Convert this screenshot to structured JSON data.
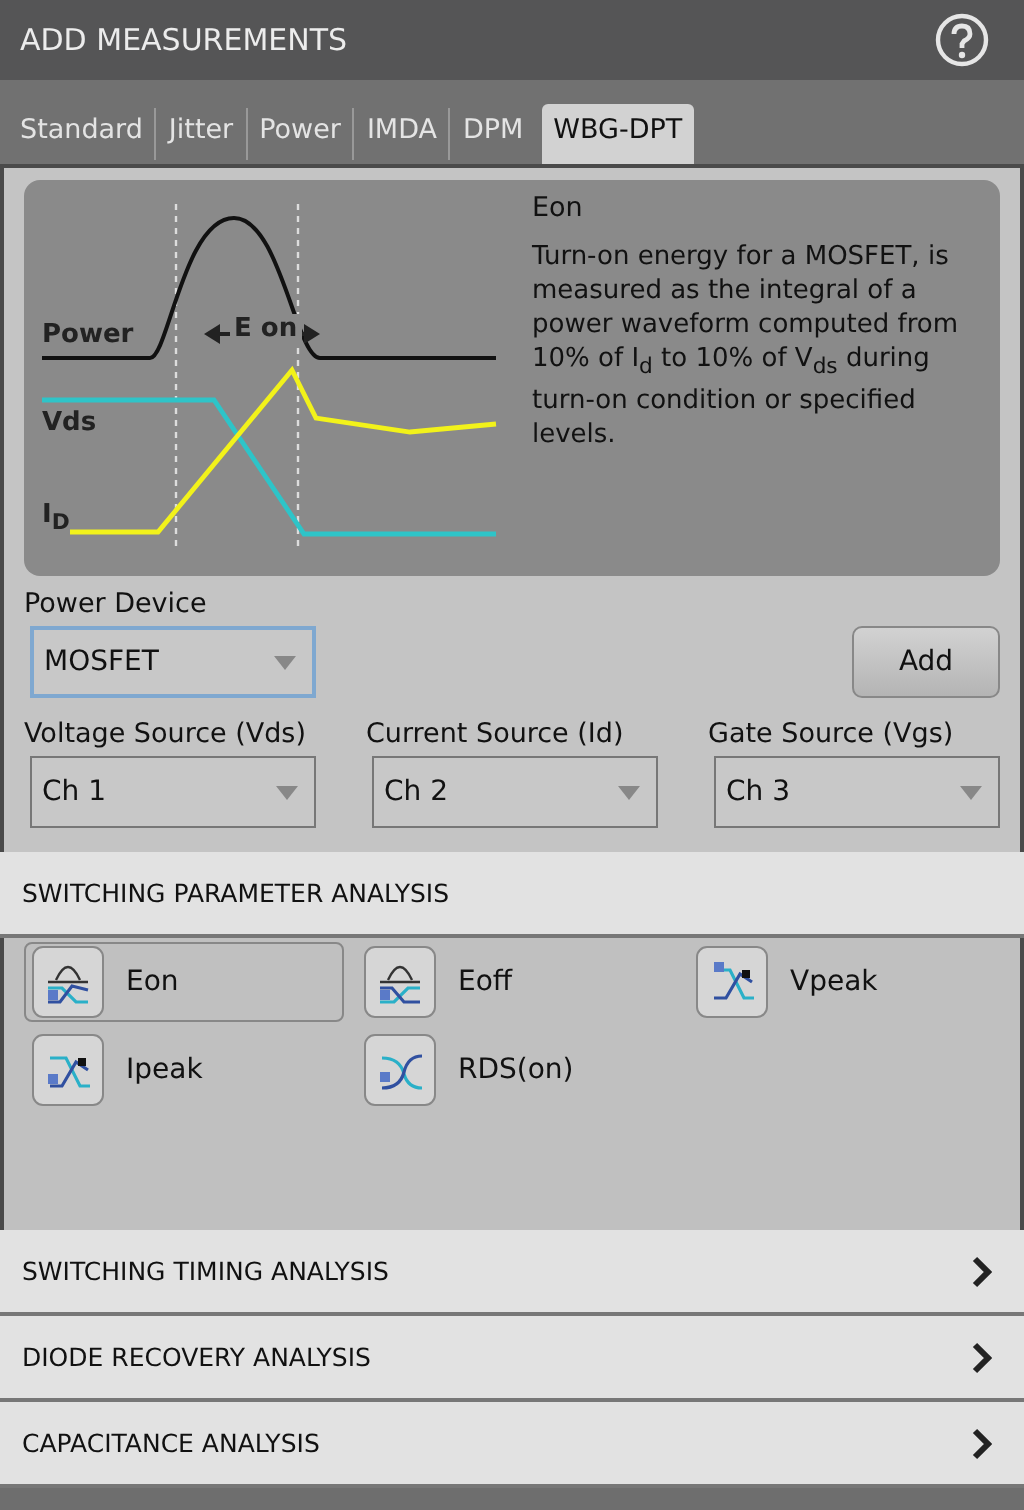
{
  "window": {
    "title": "ADD MEASUREMENTS"
  },
  "tabs": [
    {
      "label": "Standard",
      "selected": false
    },
    {
      "label": "Jitter",
      "selected": false
    },
    {
      "label": "Power",
      "selected": false
    },
    {
      "label": "IMDA",
      "selected": false
    },
    {
      "label": "DPM",
      "selected": false
    },
    {
      "label": "WBG-DPT",
      "selected": true
    }
  ],
  "info": {
    "labels": {
      "power": "Power",
      "eon": "E on",
      "vds": "Vds",
      "id": "I$_{D}$"
    },
    "title": "Eon",
    "description": "Turn-on energy for a MOSFET, is measured as the integral of a power waveform computed from 10% of I$_{d}$ to 10% of V$_{ds}$ during turn-on condition or specified levels."
  },
  "power_device": {
    "label": "Power Device",
    "value": "MOSFET",
    "focused": true
  },
  "add_button": "Add",
  "sources": [
    {
      "label": "Voltage Source (Vds)",
      "value": "Ch 1",
      "focused": false
    },
    {
      "label": "Current Source (Id)",
      "value": "Ch 2",
      "focused": false
    },
    {
      "label": "Gate Source (Vgs)",
      "value": "Ch 3",
      "focused": false
    }
  ],
  "sections": [
    {
      "title": "SWITCHING PARAMETER ANALYSIS",
      "expanded": true,
      "measurements": [
        {
          "label": "Eon",
          "kind": "eon",
          "selected": true
        },
        {
          "label": "Eoff",
          "kind": "eoff",
          "selected": false
        },
        {
          "label": "Vpeak",
          "kind": "vpeak",
          "selected": false
        },
        {
          "label": "Ipeak",
          "kind": "ipeak",
          "selected": false
        },
        {
          "label": "RDS(on)",
          "kind": "rds",
          "selected": false
        }
      ]
    },
    {
      "title": "SWITCHING TIMING ANALYSIS",
      "expanded": false
    },
    {
      "title": "DIODE RECOVERY ANALYSIS",
      "expanded": false
    },
    {
      "title": "CAPACITANCE ANALYSIS",
      "expanded": false
    }
  ]
}
